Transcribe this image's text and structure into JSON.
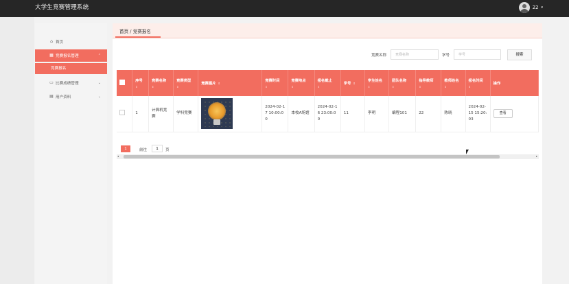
{
  "header": {
    "app_title": "大学生竞赛管理系统",
    "user_name": "22",
    "user_caret": "▾"
  },
  "sidebar": {
    "items": [
      {
        "label": "首页",
        "icon": "home-icon",
        "glyph": "⌂"
      },
      {
        "label": "竞赛报名管理",
        "icon": "grid-icon",
        "glyph": "▦",
        "chevron": "⌃"
      },
      {
        "label": "竞赛报名",
        "icon": "",
        "glyph": ""
      },
      {
        "label": "比赛成绩管理",
        "icon": "card-icon",
        "glyph": "▭",
        "chevron": "⌄"
      },
      {
        "label": "用户资料",
        "icon": "calendar-icon",
        "glyph": "▤",
        "chevron": "⌄"
      }
    ]
  },
  "breadcrumb": {
    "home": "首页",
    "sep": " / ",
    "current": "竞赛报名"
  },
  "search": {
    "name_label": "竞赛名称",
    "name_placeholder": "竞赛名称",
    "id_label": "学号",
    "id_placeholder": "学号",
    "button": "搜索"
  },
  "table": {
    "columns": [
      "序号",
      "竞赛名称",
      "竞赛类型",
      "竞赛图片",
      "竞赛时间",
      "竞赛地点",
      "报名截止",
      "学号",
      "学生姓名",
      "团队名称",
      "指导教师",
      "教师姓名",
      "报名时间",
      "操作"
    ],
    "sort_mark": "⇕",
    "rows": [
      {
        "index": "1",
        "name": "计算机竞赛",
        "type": "学科竞赛",
        "time": "2024-02-17 10:00:00",
        "place": "本校A场馆",
        "deadline": "2024-02-16 23:00:00",
        "student_id": "11",
        "student_name": "李明",
        "team": "编程101",
        "teacher_id": "22",
        "teacher_name": "陈晓",
        "signup_time": "2024-02-15 15:20:03",
        "action": "查看"
      }
    ]
  },
  "scroll": {
    "left": "◂",
    "right": "▸"
  },
  "pagination": {
    "current_page": "1",
    "goto_label": "前往",
    "goto_value": "1",
    "goto_suffix": "页"
  },
  "colors": {
    "accent": "#f26d5f",
    "topbar": "#262626"
  }
}
